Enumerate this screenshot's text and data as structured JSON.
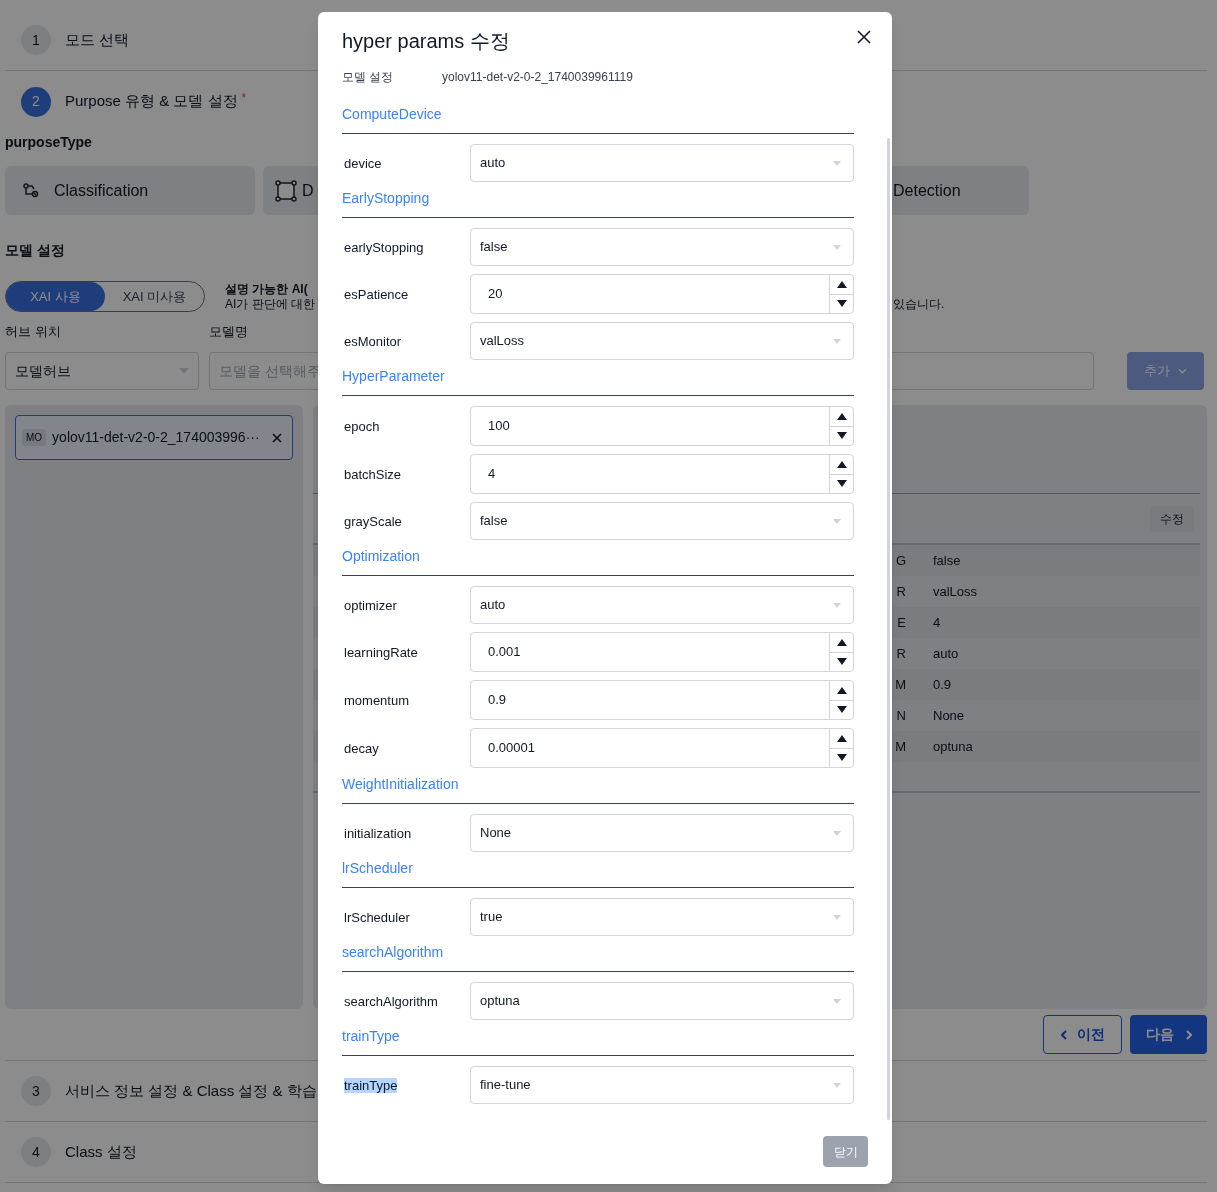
{
  "steps_top": [
    {
      "number": "1",
      "title": "모드 선택",
      "active": false
    },
    {
      "number": "2",
      "title": "Purpose 유형 & 모델 설정",
      "active": true,
      "required_mark": "*"
    }
  ],
  "purpose_type": {
    "label": "purposeType",
    "options": [
      {
        "label": "Classification"
      },
      {
        "label": "D"
      },
      {
        "label": "Detection"
      }
    ]
  },
  "model_settings": {
    "heading": "모델 설정",
    "xai_toggle": [
      {
        "label": "XAI 사용",
        "selected": true
      },
      {
        "label": "XAI 미사용",
        "selected": false
      }
    ],
    "description": {
      "title": "설명 가능한 AI(",
      "line": "AI가 판단에 대한",
      "line_end": "있습니다."
    },
    "hub_label": "허브 위치",
    "model_label": "모델명",
    "hub_value": "모델허브",
    "model_placeholder": "모델을 선택해주",
    "add_button": "추가"
  },
  "model_chip": {
    "badge": "MO",
    "name": "yolov11-det-v2-0-2_174003996···"
  },
  "params_table": {
    "edit_button": "수정",
    "rows": [
      {
        "column_1": "G",
        "column_2": "false"
      },
      {
        "column_1": "R",
        "column_2": "valLoss"
      },
      {
        "column_1": "E",
        "column_2": "4"
      },
      {
        "column_1": "R",
        "column_2": "auto"
      },
      {
        "column_1": "M",
        "column_2": "0.9"
      },
      {
        "column_1": "N",
        "column_2": "None"
      },
      {
        "column_1": "M",
        "column_2": "optuna"
      }
    ]
  },
  "nav": {
    "prev": "이전",
    "next": "다음"
  },
  "steps_bottom": [
    {
      "number": "3",
      "title": "서비스 정보 설정 & Class 설정 & 학습",
      "active": false
    },
    {
      "number": "4",
      "title": "Class 설정",
      "active": false
    }
  ],
  "modal": {
    "title": "hyper params 수정",
    "info": {
      "label": "모델 설정",
      "value": "yolov11-det-v2-0-2_1740039961119"
    },
    "groups": [
      {
        "title": "ComputeDevice",
        "fields": [
          {
            "label": "device",
            "kind": "select",
            "value": "auto",
            "highlighted": false
          }
        ]
      },
      {
        "title": "EarlyStopping",
        "fields": [
          {
            "label": "earlyStopping",
            "kind": "select",
            "value": "false",
            "highlighted": false
          },
          {
            "label": "esPatience",
            "kind": "number",
            "value": "20",
            "highlighted": false
          },
          {
            "label": "esMonitor",
            "kind": "select",
            "value": "valLoss",
            "highlighted": false
          }
        ]
      },
      {
        "title": "HyperParameter",
        "fields": [
          {
            "label": "epoch",
            "kind": "number",
            "value": "100",
            "highlighted": false
          },
          {
            "label": "batchSize",
            "kind": "number",
            "value": "4",
            "highlighted": false
          },
          {
            "label": "grayScale",
            "kind": "select",
            "value": "false",
            "highlighted": false
          }
        ]
      },
      {
        "title": "Optimization",
        "fields": [
          {
            "label": "optimizer",
            "kind": "select",
            "value": "auto",
            "highlighted": false
          },
          {
            "label": "learningRate",
            "kind": "number",
            "value": "0.001",
            "highlighted": false
          },
          {
            "label": "momentum",
            "kind": "number",
            "value": "0.9",
            "highlighted": false
          },
          {
            "label": "decay",
            "kind": "number",
            "value": "0.00001",
            "highlighted": false
          }
        ]
      },
      {
        "title": "WeightInitialization",
        "fields": [
          {
            "label": "initialization",
            "kind": "select",
            "value": "None",
            "highlighted": false
          }
        ]
      },
      {
        "title": "lrScheduler",
        "fields": [
          {
            "label": "lrScheduler",
            "kind": "select",
            "value": "true",
            "highlighted": false
          }
        ]
      },
      {
        "title": "searchAlgorithm",
        "fields": [
          {
            "label": "searchAlgorithm",
            "kind": "select",
            "value": "optuna",
            "highlighted": false
          }
        ]
      },
      {
        "title": "trainType",
        "fields": [
          {
            "label": "trainType",
            "kind": "select",
            "value": "fine-tune",
            "highlighted": true
          }
        ]
      }
    ],
    "close_button": "닫기"
  }
}
